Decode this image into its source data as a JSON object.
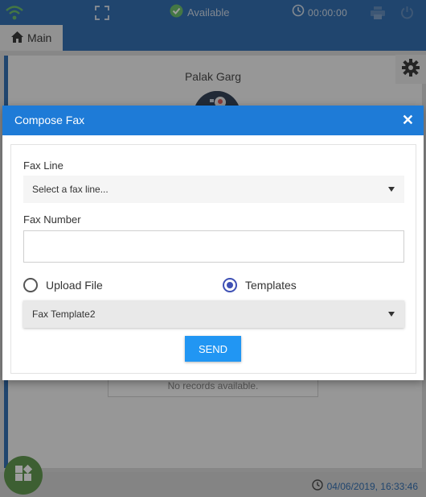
{
  "topbar": {
    "status_label": "Available",
    "timer": "00:00:00",
    "colors": {
      "bar": "#1a5ea8",
      "available": "#5cb85c"
    },
    "icons": [
      "wifi-icon",
      "fullscreen-icon",
      "available-check-icon",
      "timer-icon",
      "print-icon",
      "power-icon"
    ]
  },
  "tabs": {
    "main_label": "Main",
    "main_icon": "home-icon"
  },
  "panel": {
    "agent_name": "Palak Garg",
    "no_records": "No records available."
  },
  "footer": {
    "datetime": "04/06/2019, 16:33:46",
    "icon": "clock-icon"
  },
  "dialog": {
    "title": "Compose Fax",
    "fax_line_label": "Fax Line",
    "fax_line_value": "Select a fax line...",
    "fax_number_label": "Fax Number",
    "fax_number_value": "",
    "upload_label": "Upload File",
    "templates_label": "Templates",
    "selected_option": "Templates",
    "template_value": "Fax Template2",
    "send_label": "SEND",
    "colors": {
      "header": "#1e7bd7",
      "send": "#2196f3",
      "radio": "#3f51b5"
    }
  }
}
